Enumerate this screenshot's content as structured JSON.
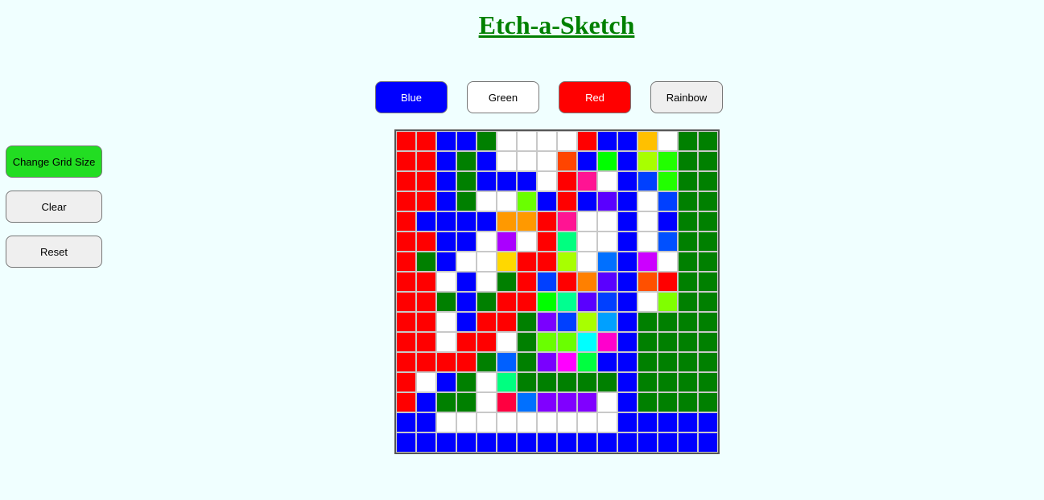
{
  "title": "Etch-a-Sketch",
  "color_buttons": {
    "blue": "Blue",
    "green": "Green",
    "red": "Red",
    "rainbow": "Rainbow"
  },
  "side_buttons": {
    "change_grid": "Change Grid Size",
    "clear": "Clear",
    "reset": "Reset"
  },
  "grid": {
    "size": 16,
    "palette": {
      "r": "#ff0000",
      "b": "#0000ff",
      "g": "#008000",
      "w": "#ffffff",
      "o": "#ff4500",
      "L": "#00ff00",
      "Y": "#ffc000",
      "y": "#a8ff00",
      "G": "#22ff00",
      "P": "#ff1493",
      "c": "#0040ff",
      "l": "#6aff00",
      "v": "#5a00ff",
      "A": "#ff9900",
      "p": "#aa00ff",
      "m": "#00ff80",
      "M": "#cc00ff",
      "d": "#ffd800",
      "e": "#0070ff",
      "f": "#ff5000",
      "h": "#ff8000",
      "k": "#ff0040",
      "s": "#00ffff",
      "n": "#ff00cc",
      "q": "#00a0ff",
      "t": "#0060ff",
      "u": "#80ff00",
      "x": "#7a00ff",
      "z": "#8000ff",
      "C": "#00ff40",
      "D": "#ff00ff",
      "E": "#00ff90",
      "F": "#0080ff",
      "H": "#0050ff"
    },
    "rows": [
      "rrbbgwwwwrbbYwgg",
      "rrbgbwwwobLbyGgg",
      "rrbgbbbwrPwbcGgg",
      "rrbgwwlbrbvbwcgg",
      "rbbbbAArPwwbwbgg",
      "rrbbwpwrmwwbwHgg",
      "rgbwwdrryweb Mwgg",
      "rrwbwgrcrhvbfrgg",
      "rrgbgrrLEvcbwugg",
      "rrwbrrgxcyqbgggg",
      "rrwrrwgllsnbgggg",
      "rrrrgtgxDCbbgggg",
      "rwbgwmgggggbgggg",
      "rbggwkezzzwbgggg",
      "bbwwwwwwwwwbbbbb",
      "bbbbbbbbbbbbbbbb"
    ]
  }
}
